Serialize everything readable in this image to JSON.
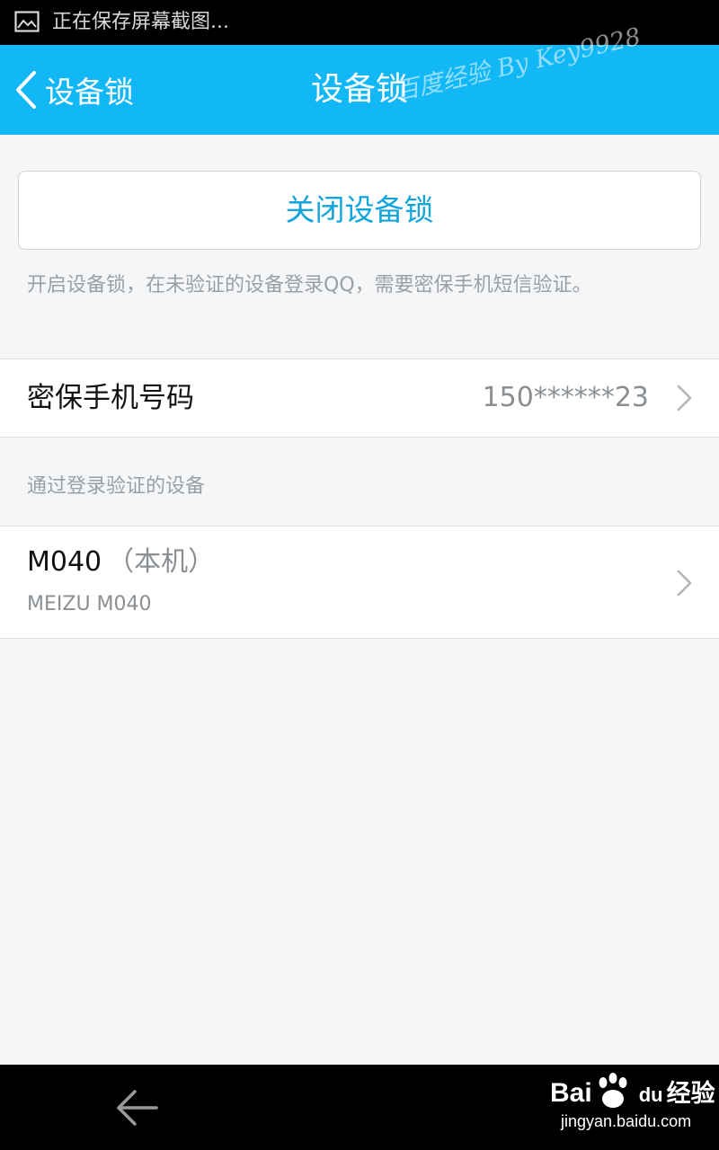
{
  "status_bar": {
    "icon": "image-icon",
    "text": "正在保存屏幕截图..."
  },
  "nav_bar": {
    "back_label": "设备锁",
    "title": "设备锁",
    "watermark": "百度经验 By Key9928",
    "color": "#12b7f5"
  },
  "device_lock": {
    "close_button_label": "关闭设备锁",
    "hint": "开启设备锁，在未验证的设备登录QQ，需要密保手机短信验证。",
    "accent_color": "#12a5dc"
  },
  "phone": {
    "label": "密保手机号码",
    "value": "150******23"
  },
  "devices_section": {
    "header": "通过登录验证的设备",
    "items": [
      {
        "name": "M040",
        "tag": "（本机）",
        "model": "MEIZU M040"
      }
    ]
  },
  "bottom_bar": {
    "back_icon": "back-arrow-icon",
    "logo_text_1": "Bai",
    "logo_text_2": "du",
    "logo_text_3": "经验",
    "logo_sub": "jingyan.baidu.com"
  }
}
